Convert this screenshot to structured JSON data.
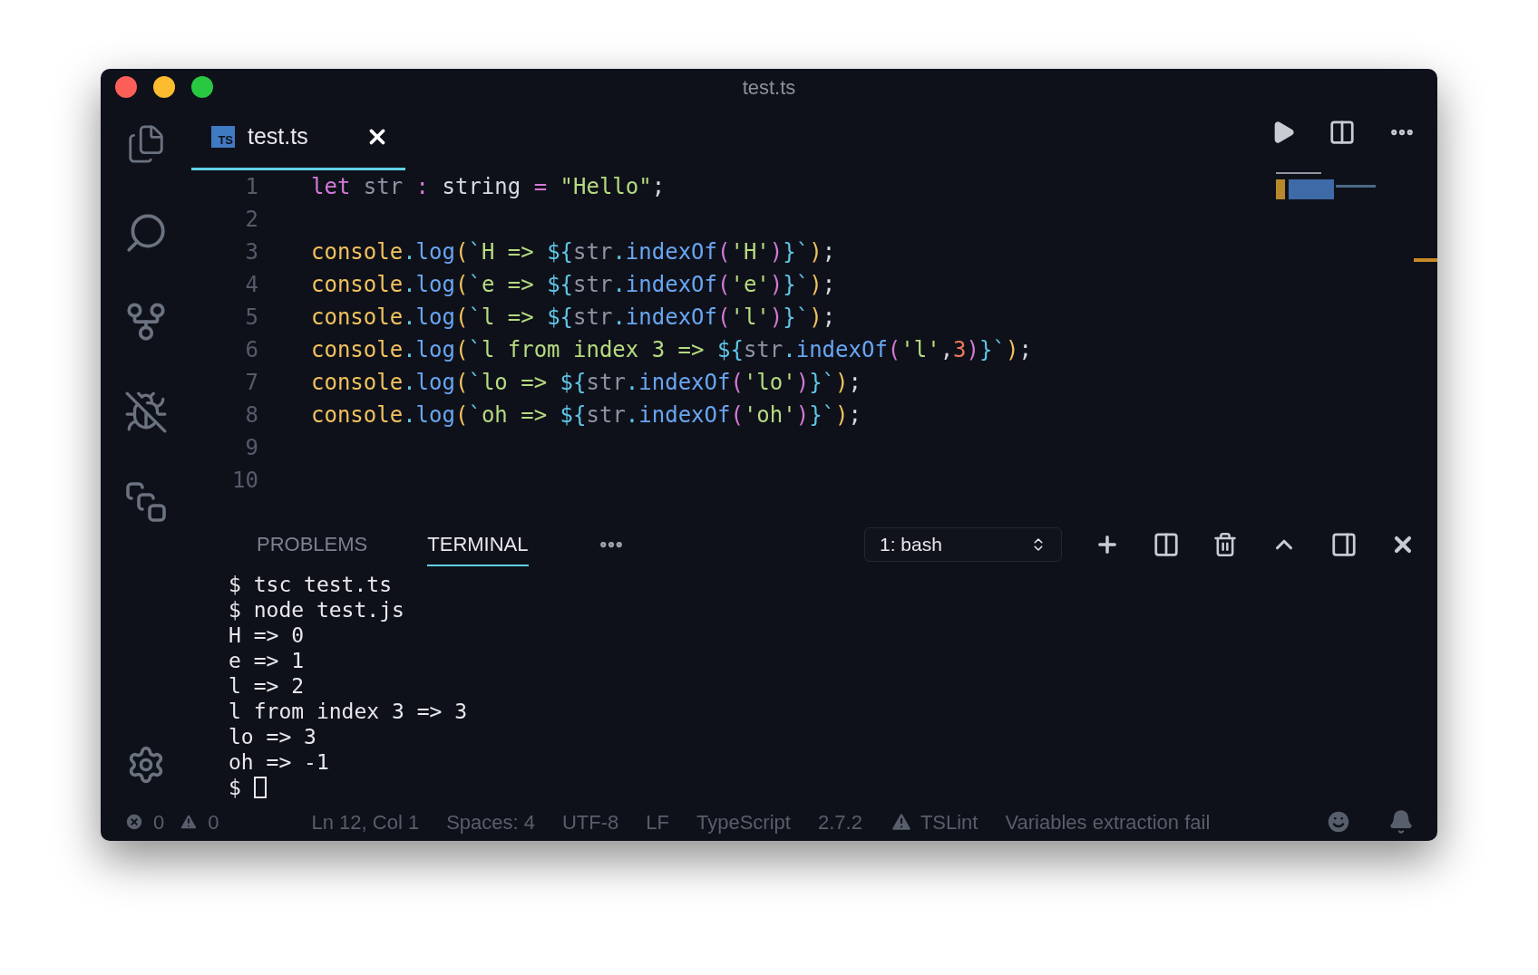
{
  "window": {
    "title": "test.ts"
  },
  "editor_tab": {
    "icon_label": "TS",
    "label": "test.ts",
    "selected": true
  },
  "code_lines": [
    {
      "number": "1",
      "tokens": [
        {
          "t": "let",
          "kind": "keyword"
        },
        {
          "t": " str ",
          "kind": "var"
        },
        {
          "t": ":",
          "kind": "op"
        },
        {
          "t": " string ",
          "kind": "type"
        },
        {
          "t": "=",
          "kind": "op"
        },
        {
          "t": " \"Hello\"",
          "kind": "string"
        },
        {
          "t": ";",
          "kind": "punct"
        }
      ]
    },
    {
      "number": "2"
    },
    {
      "number": "3",
      "tokens": [
        {
          "t": "console",
          "kind": "object"
        },
        {
          "t": ".",
          "kind": "dot"
        },
        {
          "t": "log",
          "kind": "method"
        },
        {
          "t": "(",
          "kind": "paren"
        },
        {
          "t": "`",
          "kind": "template"
        },
        {
          "t": "H => ",
          "kind": "string"
        },
        {
          "t": "${",
          "kind": "template"
        },
        {
          "t": "str",
          "kind": "var"
        },
        {
          "t": ".",
          "kind": "dot"
        },
        {
          "t": "indexOf",
          "kind": "method"
        },
        {
          "t": "(",
          "kind": "paren2"
        },
        {
          "t": "'H'",
          "kind": "string"
        },
        {
          "t": ")",
          "kind": "paren2"
        },
        {
          "t": "}`",
          "kind": "template"
        },
        {
          "t": ")",
          "kind": "paren"
        },
        {
          "t": ";",
          "kind": "punct"
        }
      ]
    },
    {
      "number": "4",
      "tokens": [
        {
          "t": "console",
          "kind": "object"
        },
        {
          "t": ".",
          "kind": "dot"
        },
        {
          "t": "log",
          "kind": "method"
        },
        {
          "t": "(",
          "kind": "paren"
        },
        {
          "t": "`",
          "kind": "template"
        },
        {
          "t": "e => ",
          "kind": "string"
        },
        {
          "t": "${",
          "kind": "template"
        },
        {
          "t": "str",
          "kind": "var"
        },
        {
          "t": ".",
          "kind": "dot"
        },
        {
          "t": "indexOf",
          "kind": "method"
        },
        {
          "t": "(",
          "kind": "paren2"
        },
        {
          "t": "'e'",
          "kind": "string"
        },
        {
          "t": ")",
          "kind": "paren2"
        },
        {
          "t": "}`",
          "kind": "template"
        },
        {
          "t": ")",
          "kind": "paren"
        },
        {
          "t": ";",
          "kind": "punct"
        }
      ]
    },
    {
      "number": "5",
      "tokens": [
        {
          "t": "console",
          "kind": "object"
        },
        {
          "t": ".",
          "kind": "dot"
        },
        {
          "t": "log",
          "kind": "method"
        },
        {
          "t": "(",
          "kind": "paren"
        },
        {
          "t": "`",
          "kind": "template"
        },
        {
          "t": "l => ",
          "kind": "string"
        },
        {
          "t": "${",
          "kind": "template"
        },
        {
          "t": "str",
          "kind": "var"
        },
        {
          "t": ".",
          "kind": "dot"
        },
        {
          "t": "indexOf",
          "kind": "method"
        },
        {
          "t": "(",
          "kind": "paren2"
        },
        {
          "t": "'l'",
          "kind": "string"
        },
        {
          "t": ")",
          "kind": "paren2"
        },
        {
          "t": "}`",
          "kind": "template"
        },
        {
          "t": ")",
          "kind": "paren"
        },
        {
          "t": ";",
          "kind": "punct"
        }
      ]
    },
    {
      "number": "6",
      "tokens": [
        {
          "t": "console",
          "kind": "object"
        },
        {
          "t": ".",
          "kind": "dot"
        },
        {
          "t": "log",
          "kind": "method"
        },
        {
          "t": "(",
          "kind": "paren"
        },
        {
          "t": "`",
          "kind": "template"
        },
        {
          "t": "l from index 3 => ",
          "kind": "string"
        },
        {
          "t": "${",
          "kind": "template"
        },
        {
          "t": "str",
          "kind": "var"
        },
        {
          "t": ".",
          "kind": "dot"
        },
        {
          "t": "indexOf",
          "kind": "method"
        },
        {
          "t": "(",
          "kind": "paren2"
        },
        {
          "t": "'l'",
          "kind": "string"
        },
        {
          "t": ",",
          "kind": "punct"
        },
        {
          "t": "3",
          "kind": "number"
        },
        {
          "t": ")",
          "kind": "paren2"
        },
        {
          "t": "}`",
          "kind": "template"
        },
        {
          "t": ")",
          "kind": "paren"
        },
        {
          "t": ";",
          "kind": "punct"
        }
      ]
    },
    {
      "number": "7",
      "tokens": [
        {
          "t": "console",
          "kind": "object"
        },
        {
          "t": ".",
          "kind": "dot"
        },
        {
          "t": "log",
          "kind": "method"
        },
        {
          "t": "(",
          "kind": "paren"
        },
        {
          "t": "`",
          "kind": "template"
        },
        {
          "t": "lo => ",
          "kind": "string"
        },
        {
          "t": "${",
          "kind": "template"
        },
        {
          "t": "str",
          "kind": "var"
        },
        {
          "t": ".",
          "kind": "dot"
        },
        {
          "t": "indexOf",
          "kind": "method"
        },
        {
          "t": "(",
          "kind": "paren2"
        },
        {
          "t": "'lo'",
          "kind": "string"
        },
        {
          "t": ")",
          "kind": "paren2"
        },
        {
          "t": "}`",
          "kind": "template"
        },
        {
          "t": ")",
          "kind": "paren"
        },
        {
          "t": ";",
          "kind": "punct"
        }
      ]
    },
    {
      "number": "8",
      "tokens": [
        {
          "t": "console",
          "kind": "object"
        },
        {
          "t": ".",
          "kind": "dot"
        },
        {
          "t": "log",
          "kind": "method"
        },
        {
          "t": "(",
          "kind": "paren"
        },
        {
          "t": "`",
          "kind": "template"
        },
        {
          "t": "oh => ",
          "kind": "string"
        },
        {
          "t": "${",
          "kind": "template"
        },
        {
          "t": "str",
          "kind": "var"
        },
        {
          "t": ".",
          "kind": "dot"
        },
        {
          "t": "indexOf",
          "kind": "method"
        },
        {
          "t": "(",
          "kind": "paren2"
        },
        {
          "t": "'oh'",
          "kind": "string"
        },
        {
          "t": ")",
          "kind": "paren2"
        },
        {
          "t": "}`",
          "kind": "template"
        },
        {
          "t": ")",
          "kind": "paren"
        },
        {
          "t": ";",
          "kind": "punct"
        }
      ]
    },
    {
      "number": "9"
    },
    {
      "number": "10"
    }
  ],
  "panel_tabs": [
    {
      "label": "PROBLEMS",
      "selected": false
    },
    {
      "label": "TERMINAL",
      "selected": true
    }
  ],
  "terminal_select": "1: bash",
  "terminal_lines": [
    "$ tsc test.ts",
    "$ node test.js",
    "H => 0",
    "e => 1",
    "l => 2",
    "l from index 3 => 3",
    "lo => 3",
    "oh => -1",
    "$ "
  ],
  "status_bar": {
    "errors": "0",
    "warnings": "0",
    "items": [
      "Ln 12, Col 1",
      "Spaces: 4",
      "UTF-8",
      "LF",
      "TypeScript",
      "2.7.2"
    ],
    "linter": "TSLint",
    "message": "Variables extraction fail"
  }
}
